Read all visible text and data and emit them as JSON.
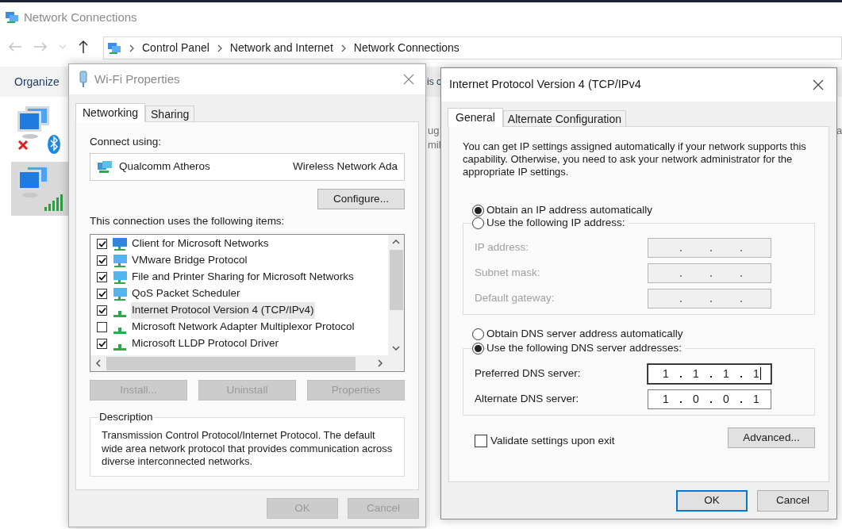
{
  "explorer": {
    "title": "Network Connections",
    "breadcrumbs": [
      "Control Panel",
      "Network and Internet",
      "Network Connections"
    ],
    "toolbar": [
      "Organize"
    ],
    "connections": [
      {
        "kind": "bluetooth",
        "selected": false
      },
      {
        "kind": "wifi",
        "selected": true
      }
    ],
    "fragments_left": [
      "is c",
      "ug",
      "mil"
    ],
    "fragments_right": [
      "a"
    ]
  },
  "wifi_dialog": {
    "title": "Wi-Fi Properties",
    "tabs": [
      {
        "label": "Networking",
        "selected": true
      },
      {
        "label": "Sharing",
        "selected": false
      }
    ],
    "connect_using_label": "Connect using:",
    "adapter": {
      "name": "Qualcomm Atheros",
      "description": "Wireless Network Ada"
    },
    "configure_button": "Configure...",
    "items_label": "This connection uses the following items:",
    "items": [
      {
        "label": "Client for Microsoft Networks",
        "checked": true,
        "kind": "client",
        "selected": false
      },
      {
        "label": "VMware Bridge Protocol",
        "checked": true,
        "kind": "service",
        "selected": false
      },
      {
        "label": "File and Printer Sharing for Microsoft Networks",
        "checked": true,
        "kind": "service",
        "selected": false
      },
      {
        "label": "QoS Packet Scheduler",
        "checked": true,
        "kind": "service",
        "selected": false
      },
      {
        "label": "Internet Protocol Version 4 (TCP/IPv4)",
        "checked": true,
        "kind": "protocol",
        "selected": true
      },
      {
        "label": "Microsoft Network Adapter Multiplexor Protocol",
        "checked": false,
        "kind": "protocol",
        "selected": false
      },
      {
        "label": "Microsoft LLDP Protocol Driver",
        "checked": true,
        "kind": "protocol",
        "selected": false
      }
    ],
    "item_buttons": [
      {
        "label": "Install...",
        "disabled": true
      },
      {
        "label": "Uninstall",
        "disabled": true
      },
      {
        "label": "Properties",
        "disabled": true
      }
    ],
    "description": {
      "legend": "Description",
      "text": "Transmission Control Protocol/Internet Protocol. The default wide area network protocol that provides communication across diverse interconnected networks."
    },
    "buttons": [
      {
        "label": "OK",
        "disabled": true
      },
      {
        "label": "Cancel",
        "disabled": true
      }
    ]
  },
  "ipv4_dialog": {
    "title": "Internet Protocol Version 4 (TCP/IPv4",
    "tabs": [
      {
        "label": "General",
        "selected": true
      },
      {
        "label": "Alternate Configuration",
        "selected": false
      }
    ],
    "intro": "You can get IP settings assigned automatically if your network supports this capability. Otherwise, you need to ask your network administrator for the appropriate IP settings.",
    "ip_options": [
      {
        "label": "Obtain an IP address automatically",
        "selected": true
      },
      {
        "label": "Use the following IP address:",
        "selected": false
      }
    ],
    "ip_fields": [
      {
        "label": "IP address:",
        "disabled": true
      },
      {
        "label": "Subnet mask:",
        "disabled": true
      },
      {
        "label": "Default gateway:",
        "disabled": true
      }
    ],
    "dns_options": [
      {
        "label": "Obtain DNS server address automatically",
        "selected": false
      },
      {
        "label": "Use the following DNS server addresses:",
        "selected": true
      }
    ],
    "dns_fields": [
      {
        "label": "Preferred DNS server:",
        "disabled": false,
        "focused": true,
        "octets": [
          "1",
          "1",
          "1",
          "1"
        ]
      },
      {
        "label": "Alternate DNS server:",
        "disabled": false,
        "focused": false,
        "octets": [
          "1",
          "0",
          "0",
          "1"
        ]
      }
    ],
    "validate": {
      "label": "Validate settings upon exit",
      "checked": false
    },
    "advanced_button": "Advanced...",
    "buttons": [
      {
        "label": "OK",
        "default": true
      },
      {
        "label": "Cancel",
        "default": false
      }
    ]
  }
}
